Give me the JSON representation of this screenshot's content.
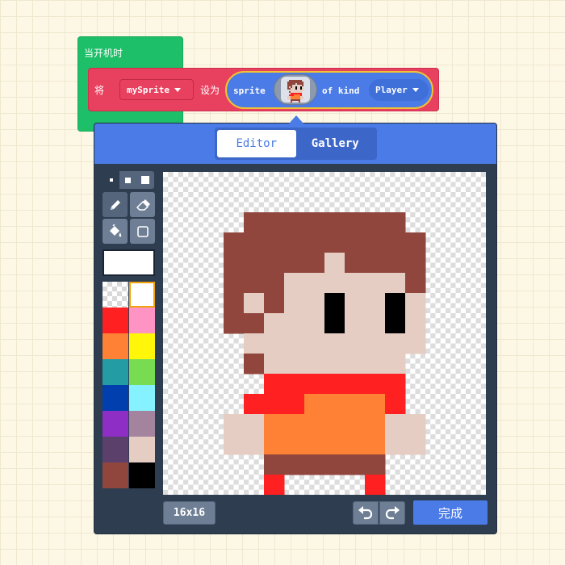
{
  "blocks": {
    "on_start_label": "当开机时",
    "set_prefix": "将",
    "variable": "mySprite",
    "set_middle": "设为",
    "sprite_word": "sprite",
    "of_kind_word": "of kind",
    "kind_value": "Player"
  },
  "editor": {
    "tabs": [
      "Editor",
      "Gallery"
    ],
    "active_tab": "Editor",
    "canvas_size": "16x16",
    "done_label": "完成",
    "selected_color": "#ffffff",
    "palette": [
      "transparent",
      "#ffffff",
      "#ff2121",
      "#ff93c4",
      "#ff8135",
      "#fff609",
      "#249ca3",
      "#78dc52",
      "#003fad",
      "#87f2ff",
      "#8e2ec4",
      "#a4839f",
      "#5c406c",
      "#e5cdc4",
      "#91463d",
      "#000000"
    ],
    "tools": [
      "pencil-icon",
      "eraser-icon",
      "fill-icon",
      "rectangle-icon"
    ],
    "sprite_pixels": [
      "................",
      "................",
      "....EEEEEEEE....",
      "...EEEEEEEEEE...",
      "...EEEEEDEEEE...",
      "...EEEDDDDDDE...",
      "...EDEDDKDDKD...",
      "...EEDDDKDDKD...",
      "....DDDDDDDDD...",
      "....EDDDDDDD....",
      ".....RRRRRRR....",
      "....RRROOOOR....",
      "...DDOOOOOODD...",
      "...DDOOOOOODD...",
      ".....EEEEEE.....",
      ".....R....R....."
    ],
    "pixel_colors": {
      "E": "#91463d",
      "D": "#e5cdc4",
      "K": "#000000",
      "R": "#ff2121",
      "O": "#ff8135"
    }
  }
}
